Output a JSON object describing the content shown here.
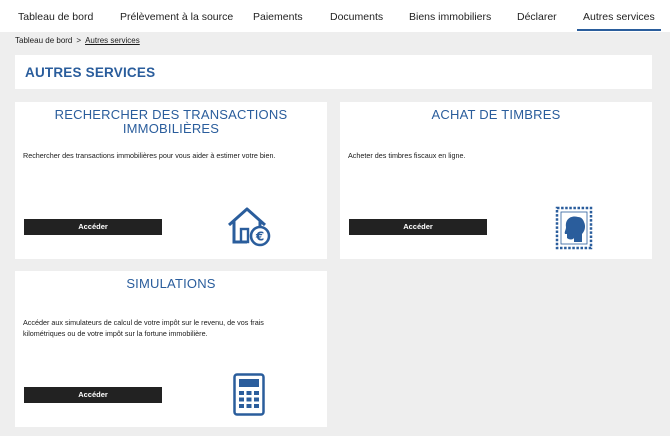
{
  "nav": {
    "items": [
      {
        "label": "Tableau de bord"
      },
      {
        "label": "Prélèvement à la source"
      },
      {
        "label": "Paiements"
      },
      {
        "label": "Documents"
      },
      {
        "label": "Biens immobiliers"
      },
      {
        "label": "Déclarer"
      },
      {
        "label": "Autres services",
        "active": true
      }
    ]
  },
  "breadcrumb": {
    "home": "Tableau de bord",
    "separator": ">",
    "current": "Autres services"
  },
  "page": {
    "title": "AUTRES SERVICES"
  },
  "cards": [
    {
      "title_line1": "RECHERCHER DES TRANSACTIONS",
      "title_line2": "IMMOBILIÈRES",
      "description": "Rechercher des transactions immobilières pour vous aider à estimer votre bien.",
      "button": "Accéder",
      "icon": "house-euro-icon"
    },
    {
      "title": "ACHAT DE TIMBRES",
      "description": "Acheter des timbres fiscaux en ligne.",
      "button": "Accéder",
      "icon": "stamp-icon"
    },
    {
      "title": "SIMULATIONS",
      "description_line1": "Accéder aux simulateurs de calcul de votre impôt sur le revenu, de vos frais",
      "description_line2": "kilométriques ou de votre impôt sur la fortune immobilière.",
      "button": "Accéder",
      "icon": "calculator-icon"
    }
  ],
  "colors": {
    "accent": "#2a5d9c",
    "background": "#eeeeee",
    "button": "#222222"
  }
}
